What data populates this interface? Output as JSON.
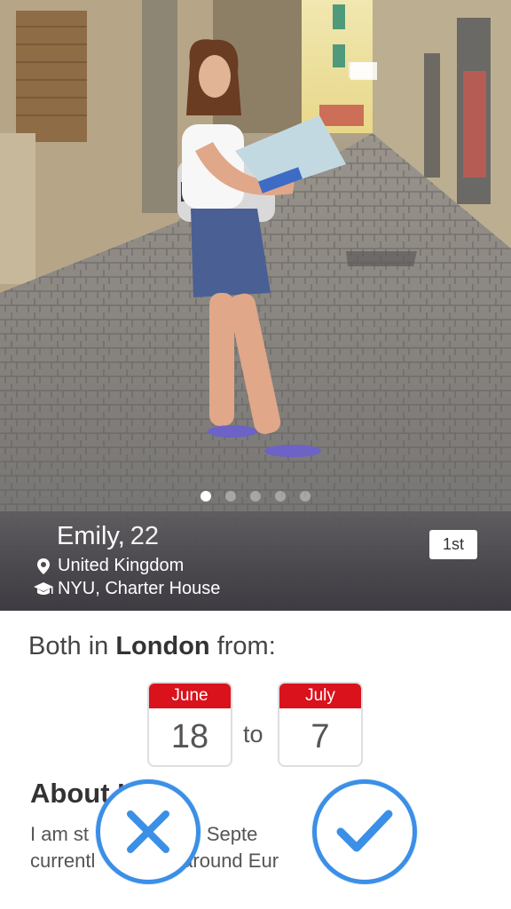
{
  "profile": {
    "name": "Emily,",
    "age": "22",
    "country": "United Kingdom",
    "school": "NYU, Charter House",
    "badge": "1st"
  },
  "photo": {
    "description_icon": "profile-photo",
    "dots_total": 5,
    "dots_active_index": 0
  },
  "match": {
    "prefix": "Both in ",
    "city": "London",
    "suffix": " from:"
  },
  "dates": {
    "from_month": "June",
    "from_day": "18",
    "to_label": "to",
    "to_month": "July",
    "to_day": "7"
  },
  "about": {
    "title": "About I",
    "line1": "I am st            YU in Septe",
    "line2": "currentl             g around Eur"
  },
  "actions": {
    "reject_icon": "close-icon",
    "accept_icon": "checkmark-icon"
  },
  "colors": {
    "accent": "#3b8fe6",
    "calendar_red": "#d9121c"
  }
}
